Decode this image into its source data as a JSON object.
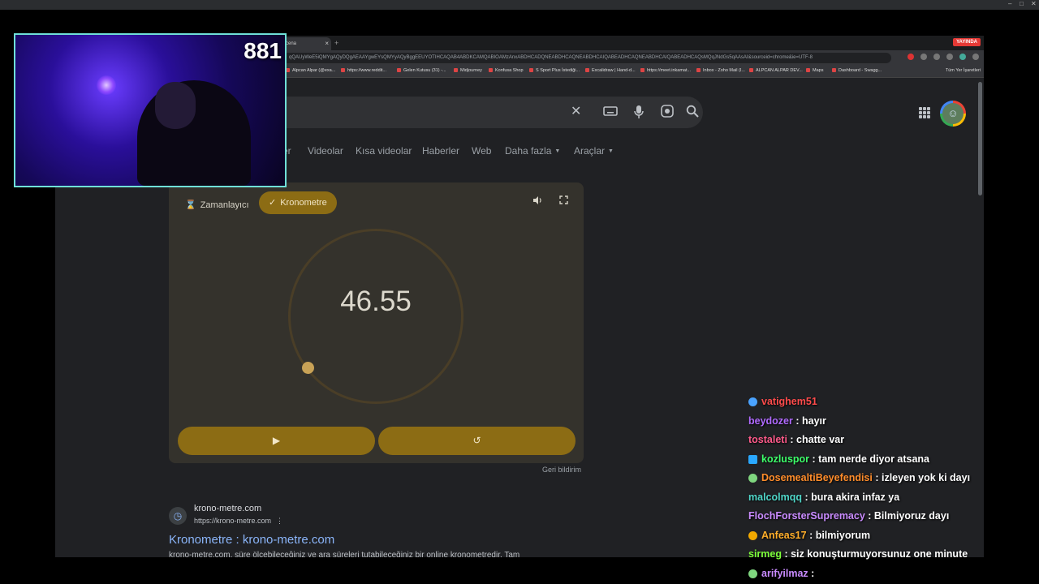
{
  "window": {
    "controls": [
      "–",
      "□",
      "✕"
    ]
  },
  "browser": {
    "tab": {
      "title": "cena",
      "close": "×"
    },
    "new_tab": "+",
    "live_badge": "YAYINDA",
    "url": "qQAUyWeE5iQMYgAQyDQgAEAAYgwEYsQMYyAQyBggEEUYOTIHCAQAB4ABDKCAMQABIOAMzAnxABDHCADQNEABDHCAQNEABDHCAIQABEADHCAQNEABDHCAIQABEADHCAQsMQqJNdGs5qAAsAI&sourceid=chrome&ie=UTF-8",
    "bookmarks": [
      "Alpcan Alpar (@exa...",
      "https://www.reddit...",
      "Gelen Kutusu (31) -...",
      "Midjourney",
      "Konfusa Shop",
      "S Sport Plus İstediği...",
      "Excalidraw | Hand-d...",
      "https://meet.inkamat...",
      "Inbox - Zoho Mail (I...",
      "ALPCAN ALPAR DEV...",
      "Maps",
      "Dashboard - Swagg..."
    ],
    "all_bookmarks": "Tüm Yer İşaretleri"
  },
  "search": {
    "icons": {
      "clear": "clear-icon",
      "keyboard": "keyboard-icon",
      "mic": "mic-icon",
      "lens": "lens-icon",
      "search": "search-icon"
    },
    "tabs": [
      {
        "label": "er"
      },
      {
        "label": "Videolar"
      },
      {
        "label": "Kısa videolar"
      },
      {
        "label": "Haberler"
      },
      {
        "label": "Web"
      },
      {
        "label": "Daha fazla"
      },
      {
        "label": "Araçlar"
      }
    ]
  },
  "stopwatch": {
    "timer_tab": "Zamanlayıcı",
    "stopwatch_tab": "Kronometre",
    "time": "46.55",
    "accent_color": "#8c6c14",
    "feedback": "Geri bildirim"
  },
  "result": {
    "site": "krono-metre.com",
    "url": "https://krono-metre.com",
    "title": "Kronometre : krono-metre.com",
    "snippet": "krono-metre.com, süre ölçebileceğiniz ve ara süreleri tutabileceğiniz bir online kronometredir. Tam"
  },
  "webcam": {
    "counter": "881"
  },
  "chat": {
    "messages": [
      {
        "user": "vatighem51",
        "text": "",
        "color": "#ff4b4b",
        "badge": "#4aa3ff"
      },
      {
        "user": "beydozer",
        "text": "hayır",
        "color": "#b06aff",
        "badge": ""
      },
      {
        "user": "tostaleti",
        "text": "chatte var",
        "color": "#ff5a8a",
        "badge": ""
      },
      {
        "user": "kozluspor",
        "text": "tam nerde diyor atsana",
        "color": "#3dff6a",
        "badge": "#2aa8ff"
      },
      {
        "user": "DosemealtiBeyefendisi",
        "text": "izleyen yok ki dayı",
        "color": "#ff8c2a",
        "badge": "#7fd67f"
      },
      {
        "user": "malcolmqq",
        "text": "bura akira infaz ya",
        "color": "#4fd6c8",
        "badge": ""
      },
      {
        "user": "FlochForsterSupremacy",
        "text": "Bilmiyoruz dayı",
        "color": "#c98bff",
        "badge": ""
      },
      {
        "user": "Anfeas17",
        "text": "bilmiyorum",
        "color": "#ffae2a",
        "badge": "#f2a900"
      },
      {
        "user": "sirmeg",
        "text": "siz konuşturmuyorsunuz one minute",
        "color": "#7dff3a",
        "badge": ""
      },
      {
        "user": "arifyilmaz",
        "text": "",
        "color": "#c98bff",
        "badge": "#7fd67f"
      }
    ]
  }
}
